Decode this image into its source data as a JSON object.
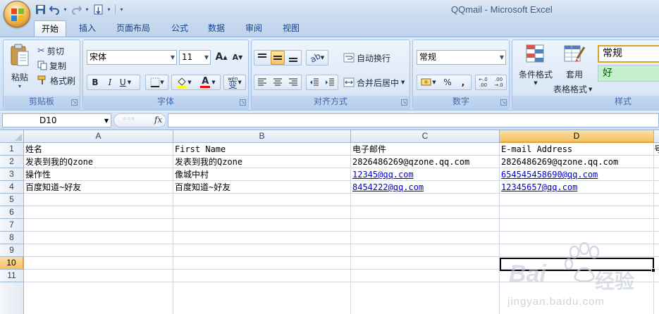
{
  "window": {
    "title": "QQmail - Microsoft Excel"
  },
  "quick_access": {
    "icons": [
      "save-icon",
      "undo-icon",
      "redo-icon",
      "print-preview-icon"
    ]
  },
  "tabs": [
    {
      "label": "开始",
      "active": true
    },
    {
      "label": "插入"
    },
    {
      "label": "页面布局"
    },
    {
      "label": "公式"
    },
    {
      "label": "数据"
    },
    {
      "label": "审阅"
    },
    {
      "label": "视图"
    }
  ],
  "ribbon": {
    "clipboard": {
      "group": "剪贴板",
      "paste": "粘贴",
      "cut": "剪切",
      "copy": "复制",
      "format_painter": "格式刷"
    },
    "font": {
      "group": "字体",
      "font_name": "宋体",
      "font_size": "11",
      "bold": "B",
      "italic": "I",
      "underline": "U",
      "grow_font": "A",
      "shrink_font": "A",
      "font_color_glyph": "A",
      "phonetic_top": "wén",
      "phonetic_char": "变"
    },
    "alignment": {
      "group": "对齐方式",
      "wrap_text": "自动换行",
      "merge_center": "合并后居中"
    },
    "number": {
      "group": "数字",
      "number_format": "常规",
      "percent": "%",
      "comma": ",",
      "inc_decimal": "←.0 .00",
      "dec_decimal": ".00 →.0"
    },
    "styles": {
      "group": "样式",
      "conditional_format": "条件格式",
      "table_format_1": "套用",
      "table_format_2": "表格格式",
      "style_normal": "常规",
      "style_good": "好",
      "good_color": "#c6efce",
      "good_text_color": "#006100"
    }
  },
  "formula_bar": {
    "name_box": "D10",
    "fx_label": "fx",
    "dots": "◦◦◦",
    "formula": ""
  },
  "sheet": {
    "columns": [
      "A",
      "B",
      "C",
      "D"
    ],
    "selected_column": "D",
    "rows": [
      "1",
      "2",
      "3",
      "4",
      "5",
      "6",
      "7",
      "8",
      "9",
      "10",
      "11"
    ],
    "selected_row": "10",
    "active_cell": "D10",
    "cells": [
      [
        "姓名",
        "First Name",
        "电子邮件",
        "E-mail Address",
        "号"
      ],
      [
        "发表到我的Qzone",
        "发表到我的Qzone",
        "2826486269@qzone.qq.com",
        "2826486269@qzone.qq.com",
        ""
      ],
      [
        "操作性",
        "像城中村",
        "12345@qq.com",
        "654545458690@qq.com",
        ""
      ],
      [
        "百度知道~好友",
        "百度知道~好友",
        "8454222@qq.com",
        "12345657@qq.com",
        ""
      ]
    ],
    "link_cells": [
      "C3",
      "D3",
      "C4",
      "D4"
    ],
    "link_color": "#0000d4",
    "selection_color": "#f5c063"
  },
  "watermark": {
    "brand": "Bai",
    "brand_cn": "经验",
    "url": "jingyan.baidu.com"
  }
}
